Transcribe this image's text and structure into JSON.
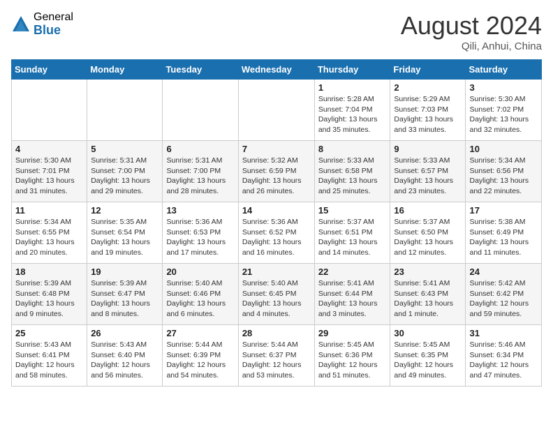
{
  "header": {
    "logo_general": "General",
    "logo_blue": "Blue",
    "month_title": "August 2024",
    "location": "Qili, Anhui, China"
  },
  "days_of_week": [
    "Sunday",
    "Monday",
    "Tuesday",
    "Wednesday",
    "Thursday",
    "Friday",
    "Saturday"
  ],
  "weeks": [
    [
      {
        "day": "",
        "info": ""
      },
      {
        "day": "",
        "info": ""
      },
      {
        "day": "",
        "info": ""
      },
      {
        "day": "",
        "info": ""
      },
      {
        "day": "1",
        "info": "Sunrise: 5:28 AM\nSunset: 7:04 PM\nDaylight: 13 hours\nand 35 minutes."
      },
      {
        "day": "2",
        "info": "Sunrise: 5:29 AM\nSunset: 7:03 PM\nDaylight: 13 hours\nand 33 minutes."
      },
      {
        "day": "3",
        "info": "Sunrise: 5:30 AM\nSunset: 7:02 PM\nDaylight: 13 hours\nand 32 minutes."
      }
    ],
    [
      {
        "day": "4",
        "info": "Sunrise: 5:30 AM\nSunset: 7:01 PM\nDaylight: 13 hours\nand 31 minutes."
      },
      {
        "day": "5",
        "info": "Sunrise: 5:31 AM\nSunset: 7:00 PM\nDaylight: 13 hours\nand 29 minutes."
      },
      {
        "day": "6",
        "info": "Sunrise: 5:31 AM\nSunset: 7:00 PM\nDaylight: 13 hours\nand 28 minutes."
      },
      {
        "day": "7",
        "info": "Sunrise: 5:32 AM\nSunset: 6:59 PM\nDaylight: 13 hours\nand 26 minutes."
      },
      {
        "day": "8",
        "info": "Sunrise: 5:33 AM\nSunset: 6:58 PM\nDaylight: 13 hours\nand 25 minutes."
      },
      {
        "day": "9",
        "info": "Sunrise: 5:33 AM\nSunset: 6:57 PM\nDaylight: 13 hours\nand 23 minutes."
      },
      {
        "day": "10",
        "info": "Sunrise: 5:34 AM\nSunset: 6:56 PM\nDaylight: 13 hours\nand 22 minutes."
      }
    ],
    [
      {
        "day": "11",
        "info": "Sunrise: 5:34 AM\nSunset: 6:55 PM\nDaylight: 13 hours\nand 20 minutes."
      },
      {
        "day": "12",
        "info": "Sunrise: 5:35 AM\nSunset: 6:54 PM\nDaylight: 13 hours\nand 19 minutes."
      },
      {
        "day": "13",
        "info": "Sunrise: 5:36 AM\nSunset: 6:53 PM\nDaylight: 13 hours\nand 17 minutes."
      },
      {
        "day": "14",
        "info": "Sunrise: 5:36 AM\nSunset: 6:52 PM\nDaylight: 13 hours\nand 16 minutes."
      },
      {
        "day": "15",
        "info": "Sunrise: 5:37 AM\nSunset: 6:51 PM\nDaylight: 13 hours\nand 14 minutes."
      },
      {
        "day": "16",
        "info": "Sunrise: 5:37 AM\nSunset: 6:50 PM\nDaylight: 13 hours\nand 12 minutes."
      },
      {
        "day": "17",
        "info": "Sunrise: 5:38 AM\nSunset: 6:49 PM\nDaylight: 13 hours\nand 11 minutes."
      }
    ],
    [
      {
        "day": "18",
        "info": "Sunrise: 5:39 AM\nSunset: 6:48 PM\nDaylight: 13 hours\nand 9 minutes."
      },
      {
        "day": "19",
        "info": "Sunrise: 5:39 AM\nSunset: 6:47 PM\nDaylight: 13 hours\nand 8 minutes."
      },
      {
        "day": "20",
        "info": "Sunrise: 5:40 AM\nSunset: 6:46 PM\nDaylight: 13 hours\nand 6 minutes."
      },
      {
        "day": "21",
        "info": "Sunrise: 5:40 AM\nSunset: 6:45 PM\nDaylight: 13 hours\nand 4 minutes."
      },
      {
        "day": "22",
        "info": "Sunrise: 5:41 AM\nSunset: 6:44 PM\nDaylight: 13 hours\nand 3 minutes."
      },
      {
        "day": "23",
        "info": "Sunrise: 5:41 AM\nSunset: 6:43 PM\nDaylight: 13 hours\nand 1 minute."
      },
      {
        "day": "24",
        "info": "Sunrise: 5:42 AM\nSunset: 6:42 PM\nDaylight: 12 hours\nand 59 minutes."
      }
    ],
    [
      {
        "day": "25",
        "info": "Sunrise: 5:43 AM\nSunset: 6:41 PM\nDaylight: 12 hours\nand 58 minutes."
      },
      {
        "day": "26",
        "info": "Sunrise: 5:43 AM\nSunset: 6:40 PM\nDaylight: 12 hours\nand 56 minutes."
      },
      {
        "day": "27",
        "info": "Sunrise: 5:44 AM\nSunset: 6:39 PM\nDaylight: 12 hours\nand 54 minutes."
      },
      {
        "day": "28",
        "info": "Sunrise: 5:44 AM\nSunset: 6:37 PM\nDaylight: 12 hours\nand 53 minutes."
      },
      {
        "day": "29",
        "info": "Sunrise: 5:45 AM\nSunset: 6:36 PM\nDaylight: 12 hours\nand 51 minutes."
      },
      {
        "day": "30",
        "info": "Sunrise: 5:45 AM\nSunset: 6:35 PM\nDaylight: 12 hours\nand 49 minutes."
      },
      {
        "day": "31",
        "info": "Sunrise: 5:46 AM\nSunset: 6:34 PM\nDaylight: 12 hours\nand 47 minutes."
      }
    ]
  ]
}
